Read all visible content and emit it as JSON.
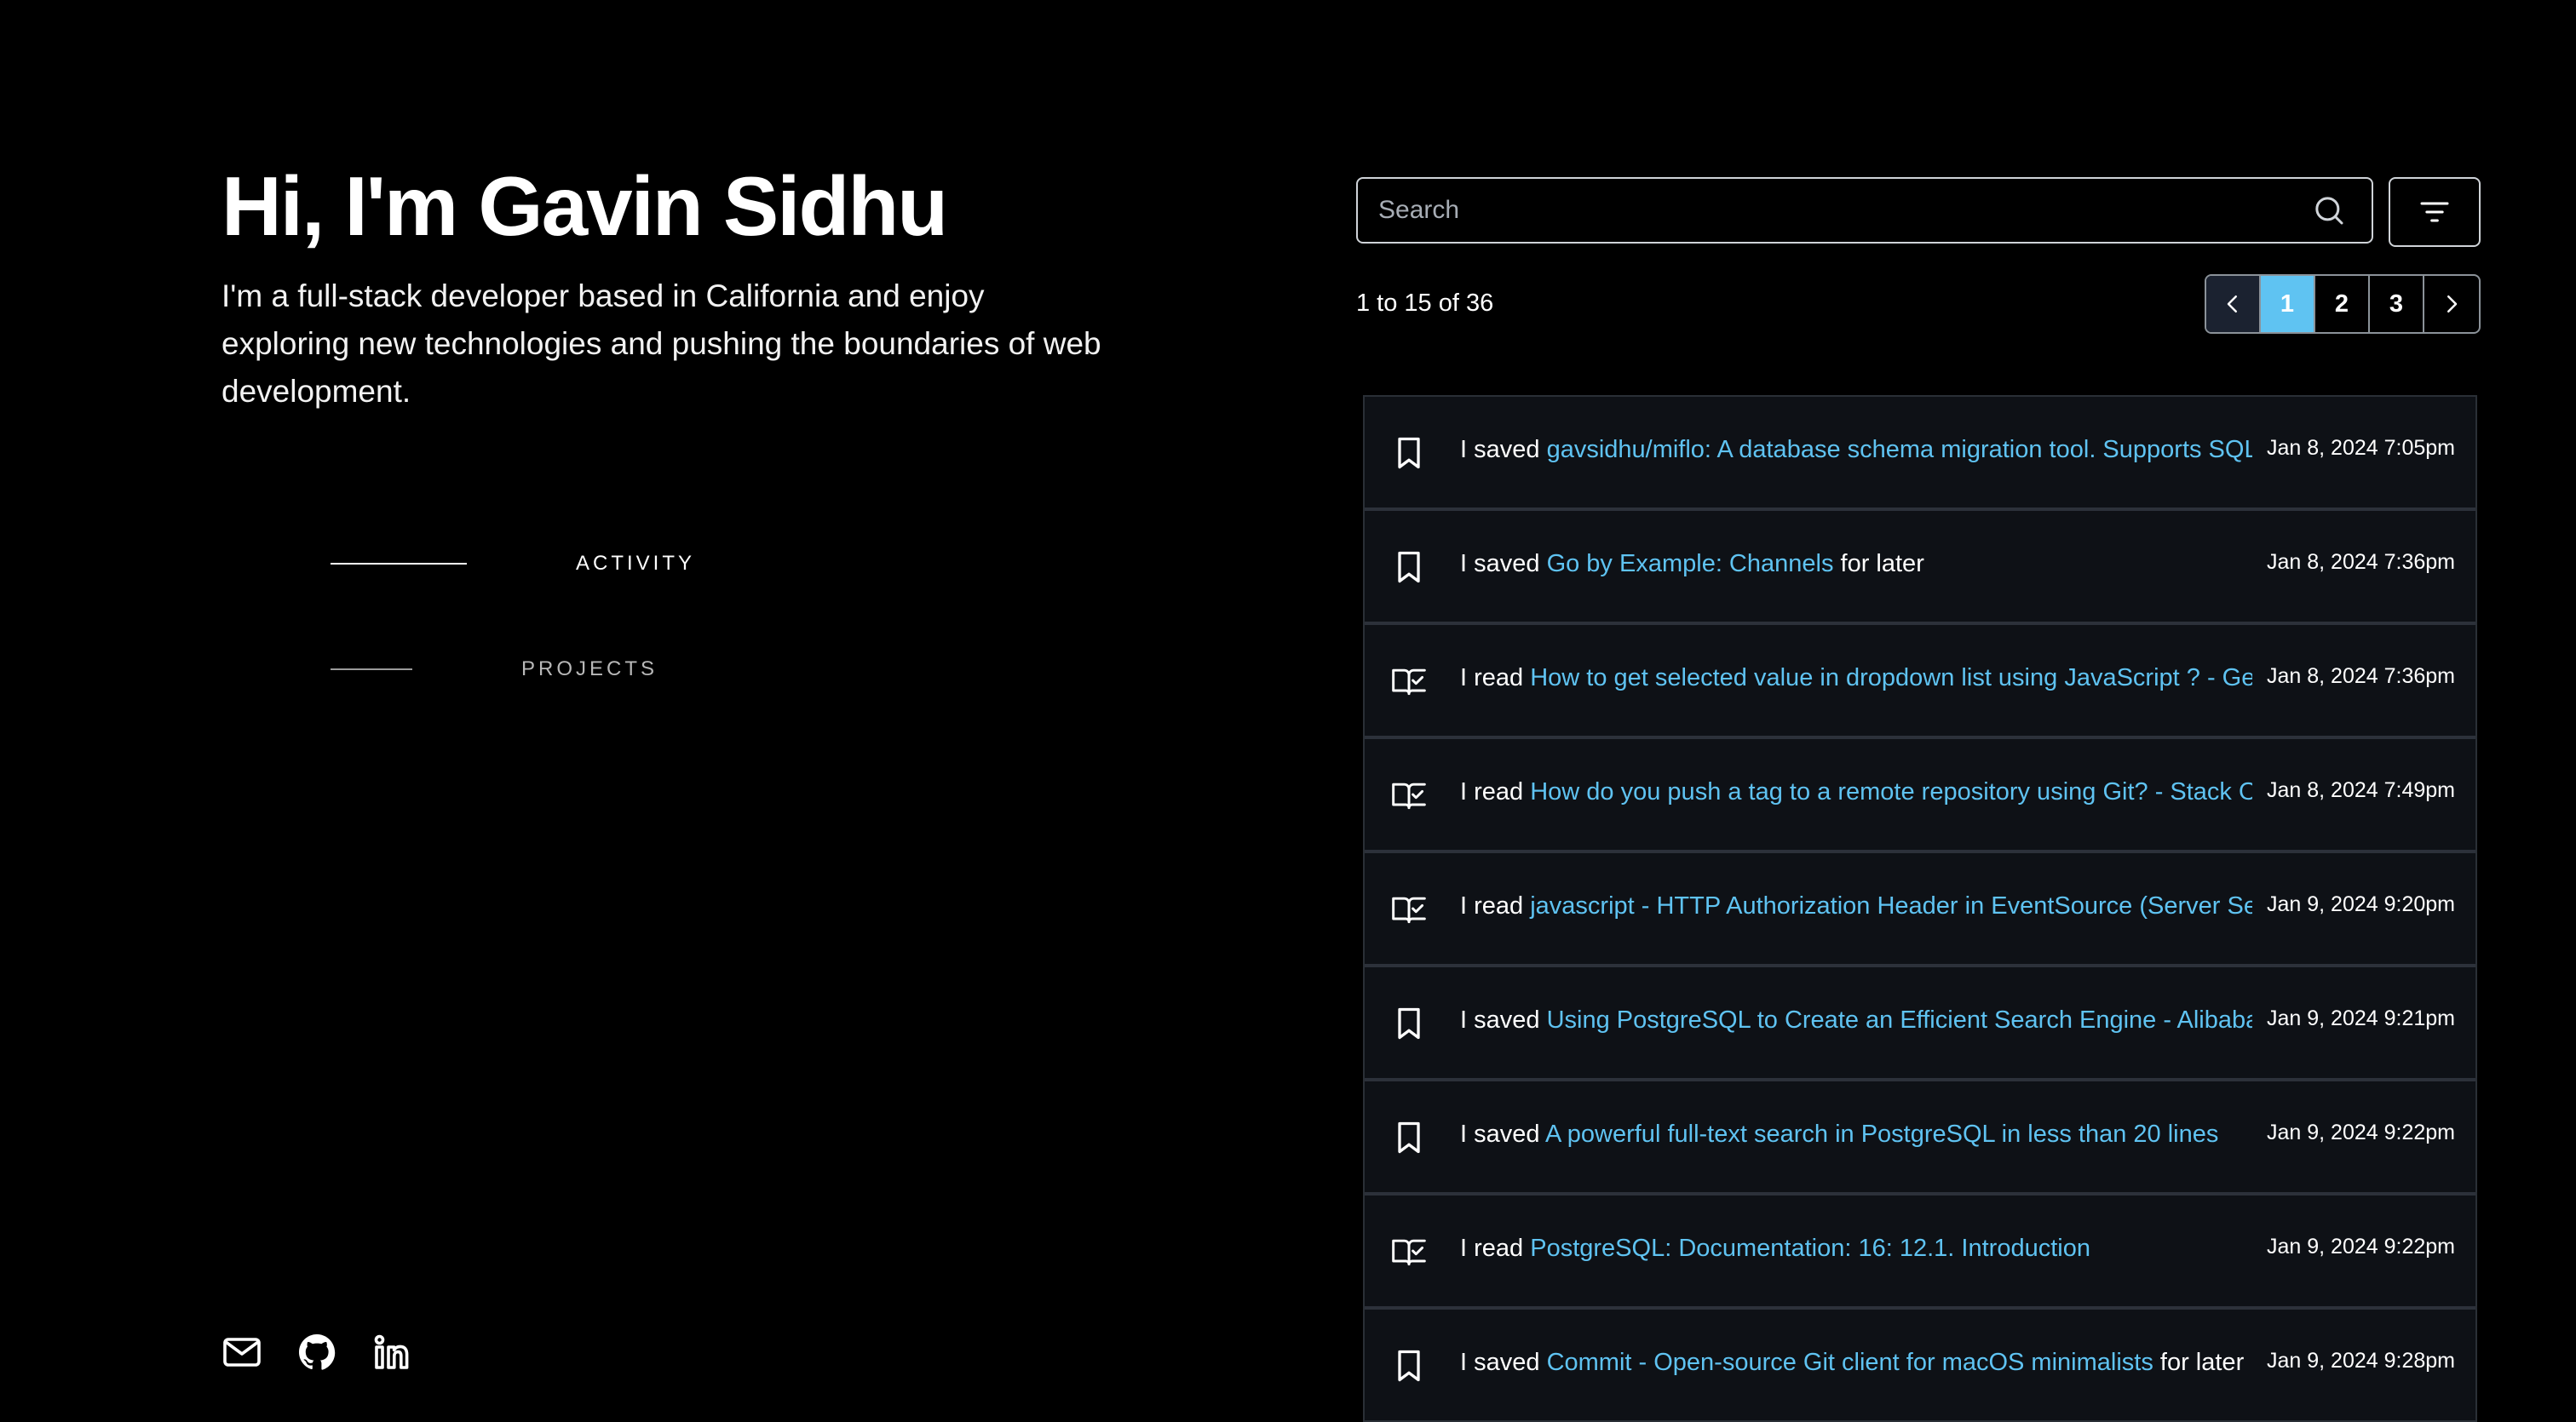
{
  "profile": {
    "name": "Hi, I'm Gavin Sidhu",
    "bio": "I'm a full-stack developer based in California and enjoy exploring new technologies and pushing the boundaries of web development."
  },
  "nav": {
    "items": [
      {
        "label": "ACTIVITY",
        "active": true
      },
      {
        "label": "PROJECTS",
        "active": false
      }
    ]
  },
  "socials": [
    "mail-icon",
    "github-icon",
    "linkedin-icon"
  ],
  "search": {
    "placeholder": "Search"
  },
  "pagination": {
    "summary": "1 to 15 of 36",
    "pages": [
      "1",
      "2",
      "3"
    ],
    "current": "1"
  },
  "feed": [
    {
      "icon": "bookmark-icon",
      "verb": "I saved",
      "link": "gavsidhu/miflo: A database schema migration tool. Supports SQLite, PostgreSQL",
      "suffix": "",
      "date": "Jan 8, 2024 7:05pm"
    },
    {
      "icon": "bookmark-icon",
      "verb": "I saved",
      "link": "Go by Example: Channels",
      "suffix": "for later",
      "date": "Jan 8, 2024 7:36pm"
    },
    {
      "icon": "book-check-icon",
      "verb": "I read",
      "link": "How to get selected value in dropdown list using JavaScript ? - GeeksforGeeks",
      "suffix": "",
      "date": "Jan 8, 2024 7:36pm"
    },
    {
      "icon": "book-check-icon",
      "verb": "I read",
      "link": "How do you push a tag to a remote repository using Git? - Stack Overflow",
      "suffix": "",
      "date": "Jan 8, 2024 7:49pm"
    },
    {
      "icon": "book-check-icon",
      "verb": "I read",
      "link": "javascript - HTTP Authorization Header in EventSource (Server Sent Events)",
      "suffix": "",
      "date": "Jan 9, 2024 9:20pm"
    },
    {
      "icon": "bookmark-icon",
      "verb": "I saved",
      "link": "Using PostgreSQL to Create an Efficient Search Engine - Alibaba Cloud",
      "suffix": "",
      "date": "Jan 9, 2024 9:21pm"
    },
    {
      "icon": "bookmark-icon",
      "verb": "I saved",
      "link": "A powerful full-text search in PostgreSQL in less than 20 lines",
      "suffix": "",
      "date": "Jan 9, 2024 9:22pm"
    },
    {
      "icon": "book-check-icon",
      "verb": "I read",
      "link": "PostgreSQL: Documentation: 16: 12.1. Introduction",
      "suffix": "",
      "date": "Jan 9, 2024 9:22pm"
    },
    {
      "icon": "bookmark-icon",
      "verb": "I saved",
      "link": "Commit - Open-source Git client for macOS minimalists",
      "suffix": "for later",
      "date": "Jan 9, 2024 9:28pm"
    }
  ],
  "colors": {
    "background": "#000000",
    "accent": "#5fc3f2",
    "row_bg": "#0e1116",
    "row_border": "#2c313a"
  }
}
